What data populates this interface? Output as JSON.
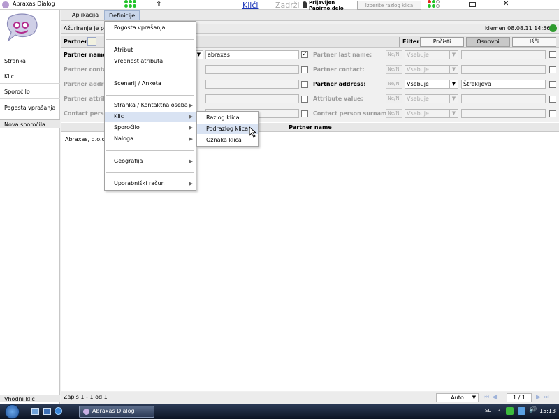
{
  "titlebar": {
    "app_title": "Abraxas Dialog",
    "home_label": "⇧",
    "klici_link": "Klići",
    "zadrzi_label": "Zadrži",
    "user_line1": "Prijavljen",
    "user_line2": "Papirno delo",
    "reason_placeholder": "Izberite razlog klica",
    "close_label": "✕"
  },
  "menubar": {
    "aplikacija": "Aplikacija",
    "definicije": "Definicije"
  },
  "sidebar": {
    "items": [
      "Stranka",
      "Klic",
      "Sporočilo",
      "Pogosta vprašanja"
    ],
    "new_message": "Nova sporočila",
    "bottom": "Vhodni klic"
  },
  "status": {
    "left": "Ažuriranje je pr",
    "right": "klemen 08.08.11 14:56"
  },
  "filter": {
    "partner_tab": "Partner",
    "filter_label": "Filter",
    "buttons": {
      "pocisti": "Počisti",
      "osnovni": "Osnovni",
      "isci": "Išči"
    },
    "left_rows": [
      {
        "label": "Partner name:",
        "value": "abraxas"
      },
      {
        "label": "Partner contac",
        "value": ""
      },
      {
        "label": "Partner addre",
        "value": ""
      },
      {
        "label": "Partner attribu",
        "value": ""
      },
      {
        "label": "Contact person",
        "value": ""
      }
    ],
    "right_rows": [
      {
        "label": "Partner last name:",
        "nn": "Ne/Ni",
        "op": "Vsebuje",
        "value": ""
      },
      {
        "label": "Partner contact:",
        "nn": "Ne/Ni",
        "op": "Vsebuje",
        "value": ""
      },
      {
        "label": "Partner address:",
        "nn": "Ne/Ni",
        "op": "Vsebuje",
        "value": "Štrekljeva"
      },
      {
        "label": "Attribute value:",
        "nn": "Ne/Ni",
        "op": "Vsebuje",
        "value": ""
      },
      {
        "label": "Contact person surname:",
        "nn": "Ne/Ni",
        "op": "Vsebuje",
        "value": ""
      }
    ]
  },
  "table": {
    "header": "Partner name",
    "rows": [
      "Abraxas, d.o.o."
    ]
  },
  "footer": {
    "records": "Zapis 1 - 1 od 1",
    "zoom": "Auto",
    "page": "1 / 1"
  },
  "definicije_menu": [
    "Pogosta vprašanja",
    "Atribut",
    "Vrednost atributa",
    "Scenarij / Anketa",
    "Stranka / Kontaktna oseba",
    "Klic",
    "Sporočilo",
    "Naloga",
    "Geografija",
    "Uporabniški račun"
  ],
  "klic_submenu": [
    "Razlog klica",
    "Podrazlog klica",
    "Oznaka klica"
  ],
  "taskbar": {
    "window": "Abraxas Dialog",
    "lang": "SL",
    "clock": "15:13"
  }
}
